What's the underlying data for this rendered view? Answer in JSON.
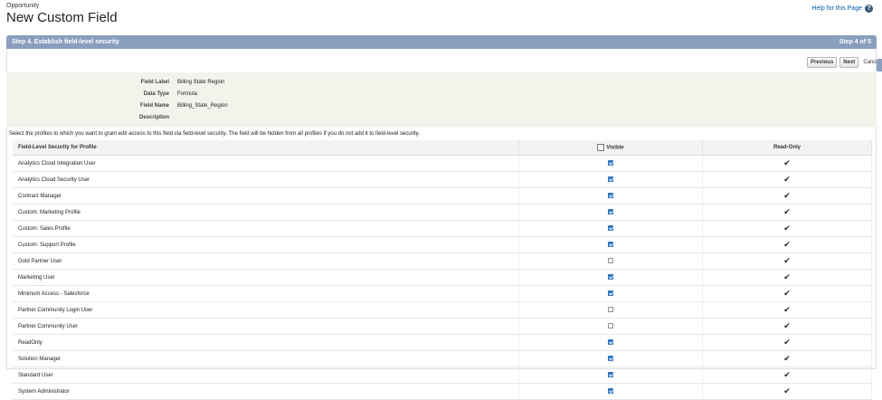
{
  "header": {
    "object_name": "Opportunity",
    "title": "New Custom Field",
    "help_link": "Help for this Page"
  },
  "step": {
    "title": "Step 4. Establish field-level security",
    "counter": "Step 4 of 5"
  },
  "buttons": {
    "previous": "Previous",
    "next": "Next",
    "cancel": "Cancel"
  },
  "field_info": {
    "label_label": "Field Label",
    "label_value": "Billing State Region",
    "type_label": "Data Type",
    "type_value": "Formula",
    "name_label": "Field Name",
    "name_value": "Billing_State_Region",
    "description_label": "Description",
    "description_value": ""
  },
  "instructions": "Select the profiles to which you want to grant edit access to this field via field-level security. The field will be hidden from all profiles if you do not add it to field-level security.",
  "table": {
    "headers": {
      "profile": "Field-Level Security for Profile",
      "visible": "Visible",
      "readonly": "Read-Only"
    },
    "rows": [
      {
        "profile": "Analytics Cloud Integration User",
        "visible": true,
        "readonly": true
      },
      {
        "profile": "Analytics Cloud Security User",
        "visible": true,
        "readonly": true
      },
      {
        "profile": "Contract Manager",
        "visible": true,
        "readonly": true
      },
      {
        "profile": "Custom: Marketing Profile",
        "visible": true,
        "readonly": true
      },
      {
        "profile": "Custom: Sales Profile",
        "visible": true,
        "readonly": true
      },
      {
        "profile": "Custom: Support Profile",
        "visible": true,
        "readonly": true
      },
      {
        "profile": "Gold Partner User",
        "visible": false,
        "readonly": true
      },
      {
        "profile": "Marketing User",
        "visible": true,
        "readonly": true
      },
      {
        "profile": "Minimum Access - Salesforce",
        "visible": true,
        "readonly": true
      },
      {
        "profile": "Partner Community Login User",
        "visible": false,
        "readonly": true
      },
      {
        "profile": "Partner Community User",
        "visible": false,
        "readonly": true
      },
      {
        "profile": "ReadOnly",
        "visible": true,
        "readonly": true
      },
      {
        "profile": "Solution Manager",
        "visible": true,
        "readonly": true
      },
      {
        "profile": "Standard User",
        "visible": true,
        "readonly": true
      },
      {
        "profile": "System Administrator",
        "visible": true,
        "readonly": true
      }
    ]
  },
  "colors": {
    "step_bar": "#8a9ebe",
    "checkbox_checked": "#2e7bd4",
    "link": "#015ba7"
  }
}
